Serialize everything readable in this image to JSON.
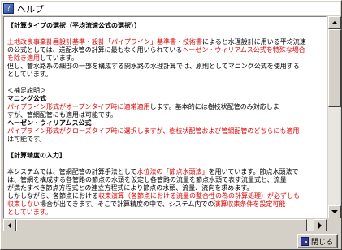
{
  "window": {
    "title": "ヘルプ",
    "icon": "help-book-icon"
  },
  "doc": {
    "h1": "【計算タイプの選択（平均流速公式の選択）】",
    "p1": [
      {
        "t": "土地改良事業計画設計基準・設計「パイプライン」基準書・技術書",
        "red": true
      },
      {
        "t": "によると水理設計に用いる平均流速",
        "red": false
      }
    ],
    "p1b": [
      {
        "t": "の公式としては、送配水管の計算に最もなく用いられている",
        "red": false
      },
      {
        "t": "ヘーゼン・ウィリアムス公式を特殊な場合",
        "red": true
      }
    ],
    "p1c": [
      {
        "t": "を除き適用",
        "red": true
      },
      {
        "t": "しています。",
        "red": false
      }
    ],
    "p2": "但し、管水路系の細部の一部を構成する開水路の水理計算では、原則としてマニング公式を使用する",
    "p2b": "としています。",
    "note": "＜補足説明＞",
    "m_title": "マニング公式",
    "m1": [
      {
        "t": "パイプライン形式がオープンタイプ時に適常適用",
        "red": true
      },
      {
        "t": "します。基本的には樹枝状配管のみ対応しま",
        "red": false
      }
    ],
    "m2": "すが、管網配管にも適用は可能です。",
    "hw_title": "ヘーゼン・ウィリアムス公式",
    "hw1": [
      {
        "t": "パイプライン形式がクローズタイプ時に選択しますが、樹枝状配管および管網配管のどちらにも適用",
        "red": true
      }
    ],
    "hw2": "は可能です。",
    "h2": "【計算精度の入力】",
    "q1": [
      {
        "t": "本システムでは、管網配管の計算手法として",
        "red": false
      },
      {
        "t": "水位法の「節点水頭法」",
        "red": true
      },
      {
        "t": "を用いています。節点水頭法で",
        "red": false
      }
    ],
    "q2": "は、管網を構成する各管路の節点の水頭を仮定し各管路の流量を節点水頭で表す流量式と、流量",
    "q3": "が満たすべき節点方程式との連立方程式により節点の水頭、流量、流向を求めます。",
    "q4": [
      {
        "t": "しかしながら、各節点における",
        "red": false
      },
      {
        "t": "収束演算（各節点における流量の整合性の為の計算処理）が必ずしも",
        "red": true
      }
    ],
    "q5": [
      {
        "t": "収束しない",
        "red": true
      },
      {
        "t": "場合が出てきます。そこで計算精度の中で、システム内での",
        "red": false
      },
      {
        "t": "演算収束条件を設定可能",
        "red": true
      }
    ],
    "q6": [
      {
        "t": "としています。",
        "red": true
      }
    ]
  },
  "buttons": {
    "close_label": "閉じる",
    "close_icon": "door-exit-icon"
  }
}
